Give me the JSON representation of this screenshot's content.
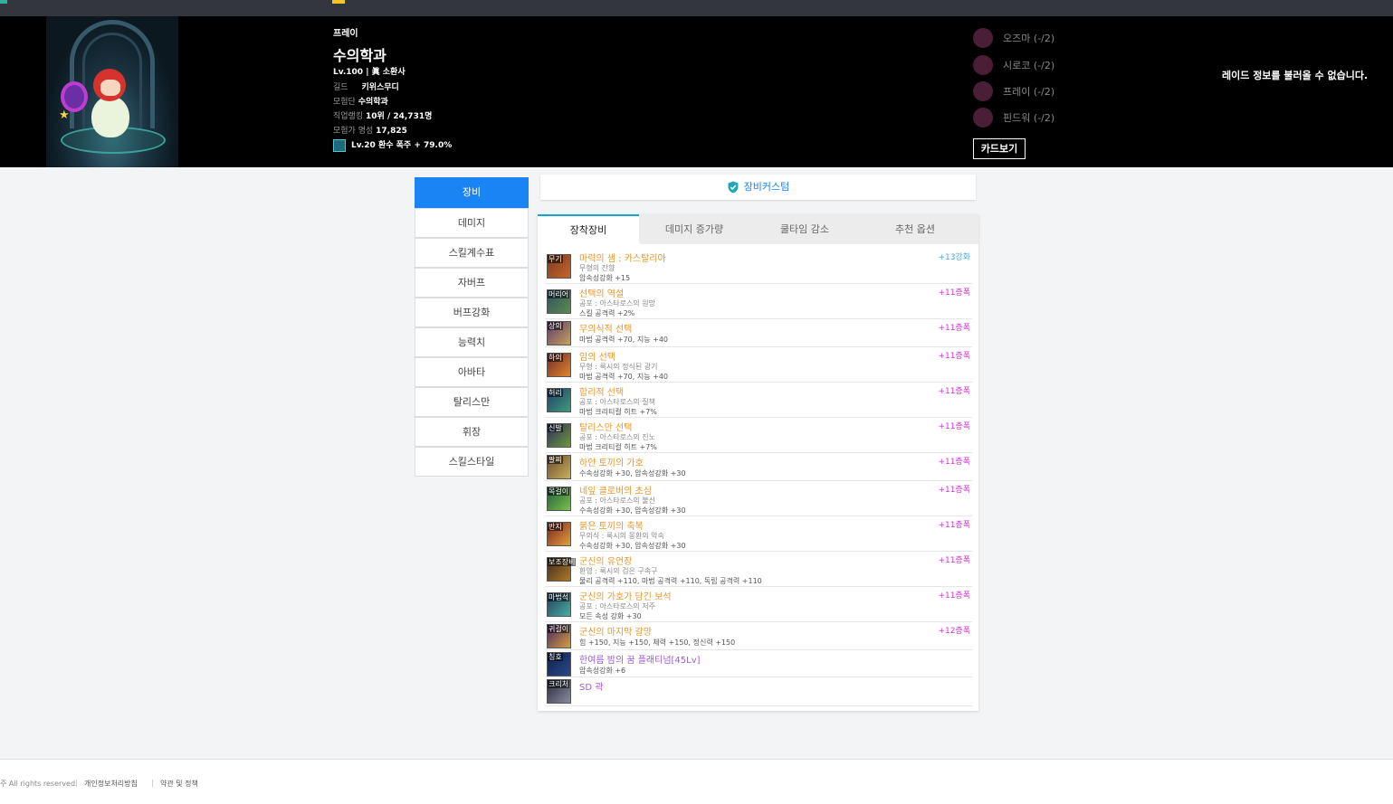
{
  "character": {
    "server": "프레이",
    "name": "수의학과",
    "level_job": "Lv.100 | 眞 소환사",
    "guild_label": "길드",
    "guild": "키위스무디",
    "adventure_label": "모험단",
    "adventure": "수의학과",
    "rank_label": "직업랭킹",
    "rank": "10위 / 24,731명",
    "fame_label": "모험가 명성",
    "fame": "17,825",
    "rune": "Lv.20 환수 폭주 + 79.0%"
  },
  "raid": {
    "members": [
      "오즈마 (-/2)",
      "시로코 (-/2)",
      "프레이 (-/2)",
      "핀드워 (-/2)"
    ],
    "card_button": "카드보기",
    "message": "레이드 정보를 불러올 수 없습니다."
  },
  "nav": {
    "items": [
      "장비",
      "데미지",
      "스킬계수표",
      "자버프",
      "버프강화",
      "능력치",
      "아바타",
      "탈리스만",
      "휘장",
      "스킬스타일"
    ]
  },
  "custom_bar": {
    "label": "장비커스텀"
  },
  "tabs": [
    "장착장비",
    "데미지 증가량",
    "쿨타임 감소",
    "추천 옵션"
  ],
  "equipment": [
    {
      "tag": "무기",
      "name": "마력의 샘 : 카스탈리아",
      "sub": "무형의 잔향",
      "stat": "암속성강화 +15",
      "enchant": "+13강화"
    },
    {
      "tag": "머리어",
      "name": "선택의 역설",
      "sub": "공포 : 아스타로스의 원망",
      "stat": "스킬 공격력 +2%",
      "enchant": "+11증폭"
    },
    {
      "tag": "상의",
      "name": "무의식적 선택",
      "sub": "",
      "stat": "마법 공격력 +70, 지능 +40",
      "enchant": "+11증폭"
    },
    {
      "tag": "하의",
      "name": "임의 선택",
      "sub": "무형 : 룩시의 정식된 광기",
      "stat": "마법 공격력 +70, 지능 +40",
      "enchant": "+11증폭"
    },
    {
      "tag": "허리",
      "name": "합리적 선택",
      "sub": "공포 : 아스타로스의 질책",
      "stat": "마법 크리티컬 히트 +7%",
      "enchant": "+11증폭"
    },
    {
      "tag": "신발",
      "name": "탈리스만 선택",
      "sub": "공포 : 아스타로스의 진노",
      "stat": "마법 크리티컬 히트 +7%",
      "enchant": "+11증폭"
    },
    {
      "tag": "팔찌",
      "name": "하얀 토끼의 가호",
      "sub": "",
      "stat": "수속성강화 +30, 암속성강화 +30",
      "enchant": "+11증폭"
    },
    {
      "tag": "목걸이",
      "name": "네잎 클로버의 초심",
      "sub": "공포 : 아스타로스의 불신",
      "stat": "수속성강화 +30, 암속성강화 +30",
      "enchant": "+11증폭"
    },
    {
      "tag": "반지",
      "name": "붉은 토끼의 축복",
      "sub": "무의식 : 룩시의 몽환의 악속",
      "stat": "수속성강화 +30, 암속성강화 +30",
      "enchant": "+11증폭"
    },
    {
      "tag": "보조장비",
      "name": "군신의 유언장",
      "sub": "환영 : 룩시의 검은 구속구",
      "stat": "물리 공격력 +110, 마법 공격력 +110, 독립 공격력 +110",
      "enchant": "+11증폭"
    },
    {
      "tag": "마법석",
      "name": "군신의 가호가 담긴 보석",
      "sub": "공포 : 아스타로스의 저주",
      "stat": "모든 속성 강화 +30",
      "enchant": "+11증폭"
    },
    {
      "tag": "귀걸이",
      "name": "군신의 마지막 갈망",
      "sub": "",
      "stat": "힘 +150, 지능 +150, 체력 +150, 정신력 +150",
      "enchant": "+12증폭"
    },
    {
      "tag": "칭호",
      "name": "한여름 밤의 꿈 플래티넘[45Lv]",
      "sub": "",
      "stat": "암속성강화 +6",
      "enchant": ""
    },
    {
      "tag": "크리처",
      "name": "SD 곽",
      "sub": "",
      "stat": "",
      "enchant": ""
    }
  ],
  "footer": {
    "copyright": "주 All rights reserved.",
    "privacy": "개인정보처리방침",
    "terms": "약관 및 정책"
  },
  "colors": {
    "accent": "#1a84f5",
    "item_epic": "#e8962a",
    "item_legendary": "#a05ad8",
    "amplify": "#d633d6",
    "reinforce": "#3fa7e8"
  }
}
